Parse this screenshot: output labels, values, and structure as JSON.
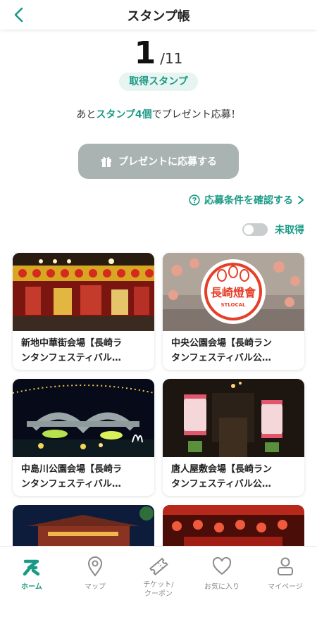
{
  "header": {
    "title": "スタンプ帳"
  },
  "progress": {
    "acquired": "1",
    "total": "/11",
    "label": "取得スタンプ"
  },
  "remaining": {
    "prefix": "あと",
    "highlight": "スタンプ4個",
    "suffix": "でプレゼント応募！"
  },
  "apply_button": {
    "label": "プレゼントに応募する",
    "icon": "gift-icon"
  },
  "terms_link": {
    "label": "応募条件を確認する"
  },
  "filter": {
    "toggle_label": "未取得",
    "toggle_on": false
  },
  "stamps": [
    {
      "line1": "新地中華街会場【長崎ラ",
      "line2": "ンタンフェスティバル…",
      "acquired": false
    },
    {
      "line1": "中央公園会場【長崎ラン",
      "line2": "タンフェスティバル公…",
      "acquired": true,
      "stamp_text": "長崎燈會",
      "stamp_sub": "STLOCAL"
    },
    {
      "line1": "中島川公園会場【長崎ラ",
      "line2": "ンタンフェスティバル…",
      "acquired": false
    },
    {
      "line1": "唐人屋敷会場【長崎ラン",
      "line2": "タンフェスティバル公…",
      "acquired": false,
      "lantern_text": "長崎燈會"
    }
  ],
  "tabbar": {
    "items": [
      {
        "label": "ホーム",
        "icon": "home-s-icon",
        "active": true
      },
      {
        "label": "マップ",
        "icon": "map-pin-icon",
        "active": false
      },
      {
        "label": "チケット/\nクーポン",
        "icon": "ticket-icon",
        "active": false
      },
      {
        "label": "お気に入り",
        "icon": "heart-icon",
        "active": false
      },
      {
        "label": "マイページ",
        "icon": "user-icon",
        "active": false
      }
    ]
  },
  "colors": {
    "accent": "#1a9a86",
    "button_disabled": "#a9b3b2",
    "pill_bg": "#e7f4f1"
  }
}
